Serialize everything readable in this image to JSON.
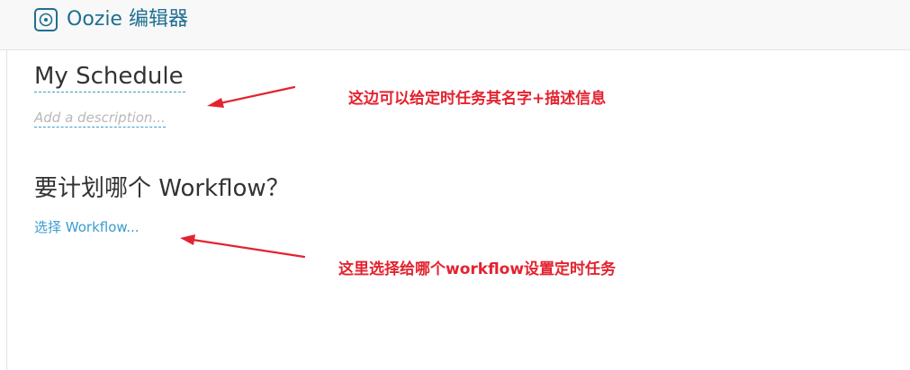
{
  "header": {
    "app_title": "Oozie 编辑器",
    "app_icon": "target-circle-icon",
    "accent_color": "#1f6f91"
  },
  "schedule": {
    "name": "My Schedule",
    "description_placeholder": "Add a description..."
  },
  "workflow_section": {
    "question": "要计划哪个 Workflow？",
    "select_link": "选择 Workflow..."
  },
  "annotations": [
    {
      "text": "这边可以给定时任务其名字+描述信息",
      "color": "#e3232f"
    },
    {
      "text": "这里选择给哪个workflow设置定时任务",
      "color": "#e3232f"
    }
  ]
}
